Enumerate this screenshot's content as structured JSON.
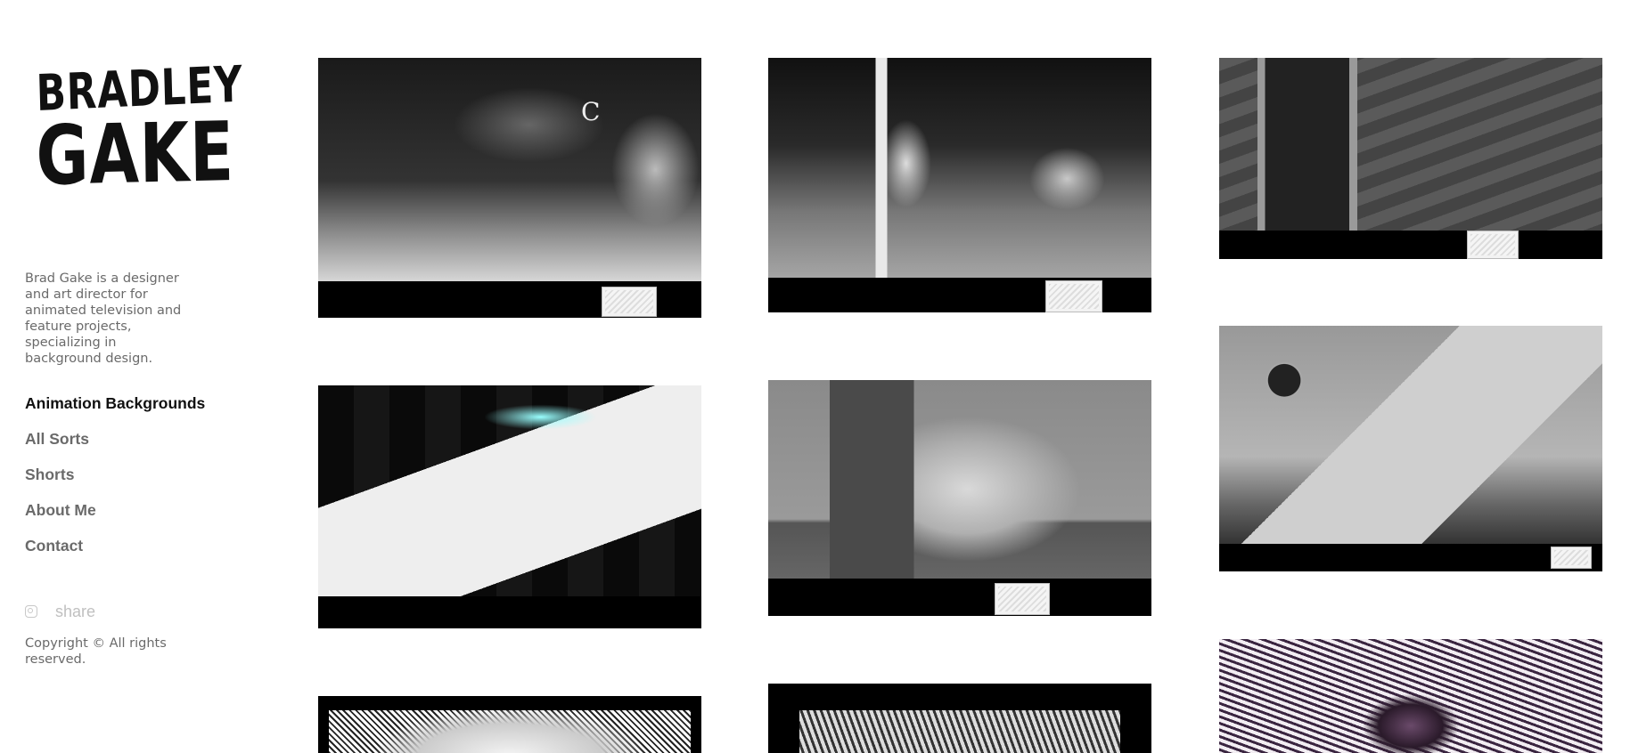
{
  "site": {
    "logo_line1": "BRADLEY",
    "logo_line2": "GAKE",
    "bio": "Brad Gake is a designer and art director for animated television and feature projects, specializing in background design."
  },
  "nav": {
    "items": [
      {
        "label": "Animation Backgrounds",
        "active": true
      },
      {
        "label": "All Sorts",
        "active": false
      },
      {
        "label": "Shorts",
        "active": false
      },
      {
        "label": "About Me",
        "active": false
      },
      {
        "label": "Contact",
        "active": false
      }
    ]
  },
  "social": {
    "icon": "instagram-icon",
    "share_label": "share"
  },
  "footer": {
    "copyright": "Copyright © All rights reserved."
  },
  "gallery": {
    "items": [
      {
        "subject": "haunted-mansion"
      },
      {
        "subject": "porch-lantern-mirror"
      },
      {
        "subject": "attic-mirror"
      },
      {
        "subject": "concert-stage"
      },
      {
        "subject": "evil-plans-desk"
      },
      {
        "subject": "vault-money-bags"
      },
      {
        "subject": "ink-landscape"
      },
      {
        "subject": "ink-interior"
      },
      {
        "subject": "ink-dome-purple"
      }
    ],
    "moon_glyph": "C",
    "colors": {
      "frame": "#000000",
      "stage_glow": "#99ffff",
      "ink_accent": "#3a2540"
    }
  },
  "colors": {
    "nav_active": "#111111",
    "nav_inactive": "#6a6a6a",
    "muted_text": "#6a6a6a",
    "share": "#c0c0c0"
  }
}
